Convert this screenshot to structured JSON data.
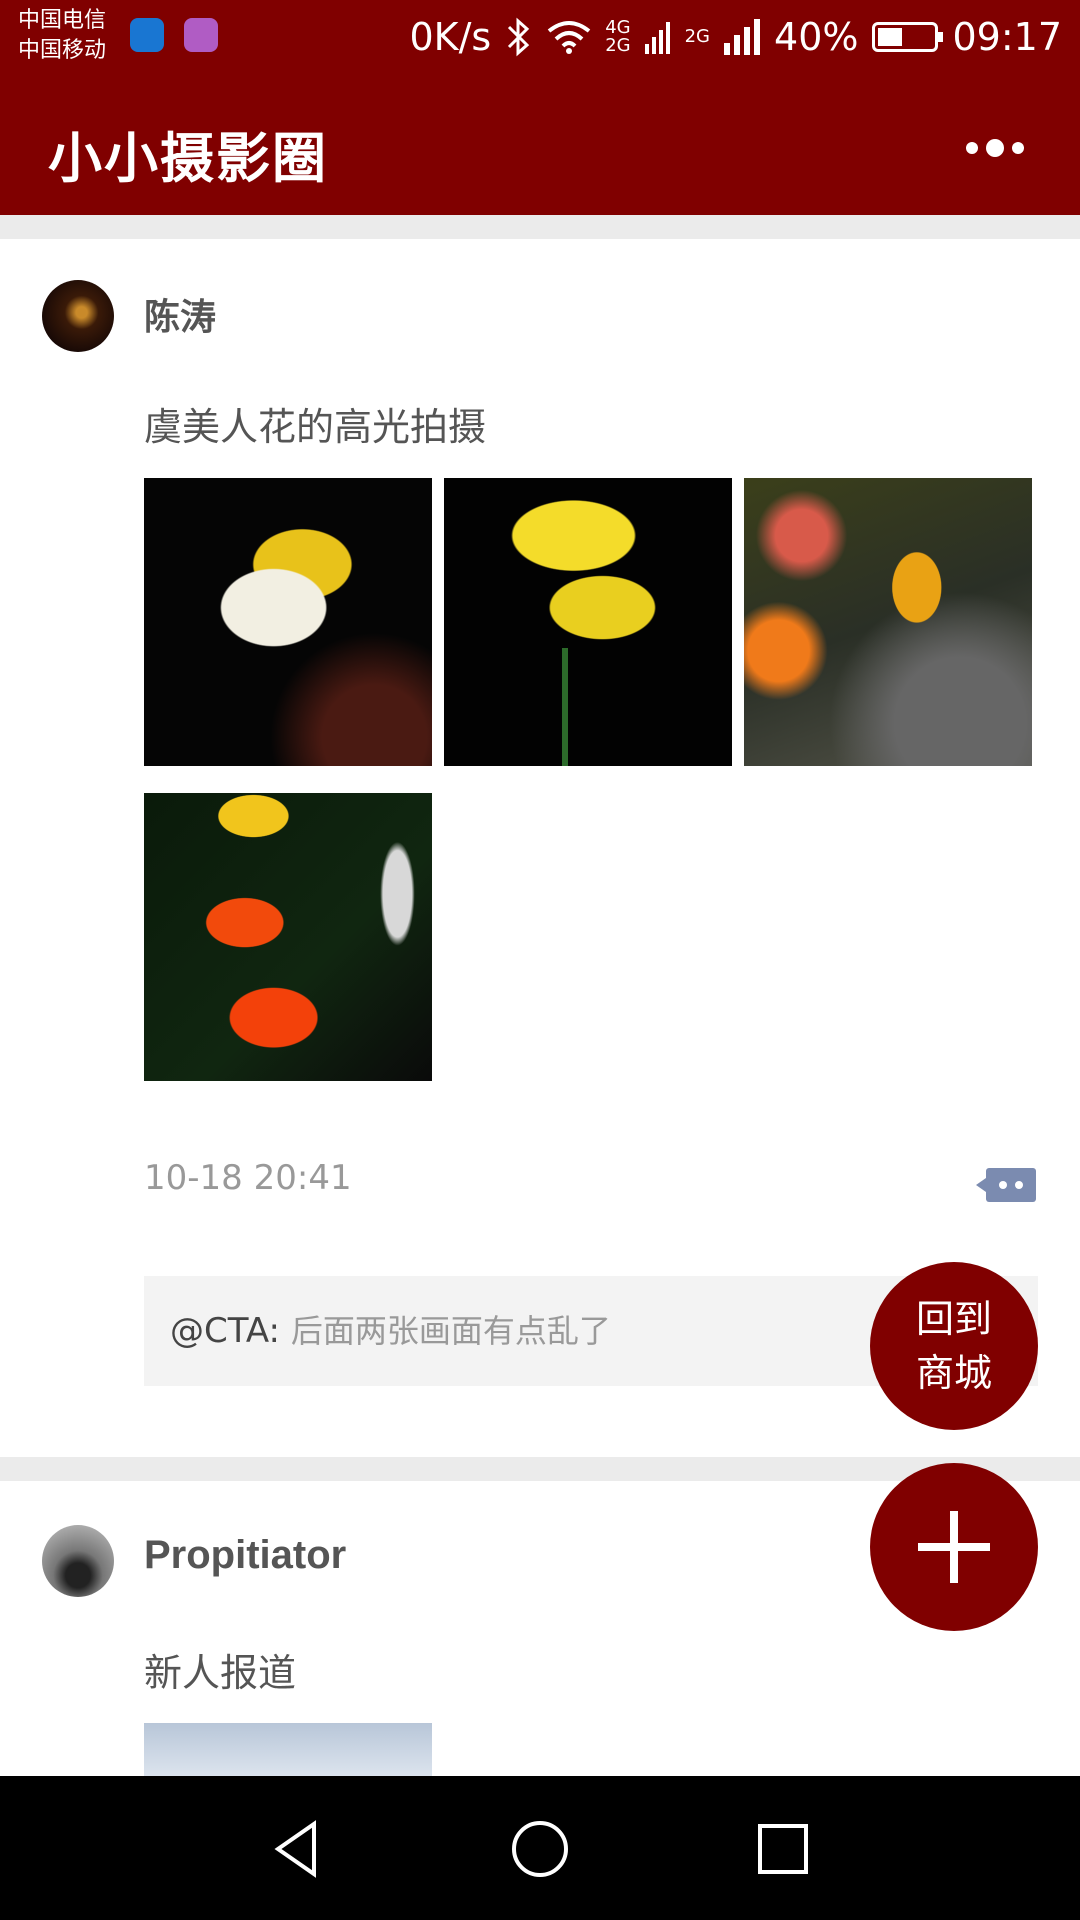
{
  "status_bar": {
    "carrier_1": "中国电信",
    "carrier_2": "中国移动",
    "net_speed": "0K/s",
    "net_4g": "4G",
    "net_2g_a": "2G",
    "net_2g_b": "2G",
    "battery": "40%",
    "battery_level": 0.4,
    "time": "09:17"
  },
  "header": {
    "title": "小小摄影圈"
  },
  "posts": [
    {
      "author": "陈涛",
      "text": "虞美人花的高光拍摄",
      "timestamp": "10-18 20:41",
      "comment": {
        "user": "@CTA:",
        "text": "后面两张画面有点乱了"
      }
    },
    {
      "author": "Propitiator",
      "text": "新人报道"
    }
  ],
  "fab": {
    "mall_line1": "回到",
    "mall_line2": "商城"
  }
}
